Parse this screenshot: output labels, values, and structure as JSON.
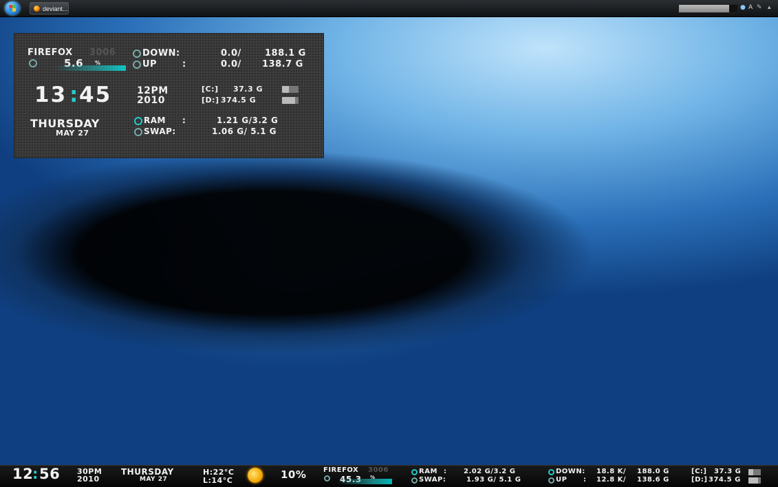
{
  "taskbar": {
    "task_label": "deviant...",
    "tray_icons": [
      "A"
    ]
  },
  "widget": {
    "process_name": "FIREFOX",
    "process_pid": "3006",
    "cpu_percent": "5.6",
    "cpu_unit": "%",
    "net_down_label": "DOWN:",
    "net_down_value": "0.0/",
    "net_down_total": "188.1 G",
    "net_up_label": "UP",
    "net_up_colon": ":",
    "net_up_value": "0.0/",
    "net_up_total": "138.7 G",
    "time": "13:45",
    "time_hh": "13",
    "time_mm": "45",
    "ampm": "12PM",
    "year": "2010",
    "drive_c_label": "[C:]",
    "drive_c_value": "37.3 G",
    "drive_d_label": "[D:]",
    "drive_d_value": "374.5 G",
    "day": "THURSDAY",
    "date": "MAY 27",
    "ram_label": "RAM",
    "ram_colon": ":",
    "ram_value": "1.21 G/3.2 G",
    "swap_label": "SWAP:",
    "swap_value": "1.06 G/ 5.1 G"
  },
  "bottom": {
    "time_hh": "12",
    "time_mm": "56",
    "ampm": "30PM",
    "year": "2010",
    "day": "THURSDAY",
    "date": "MAY 27",
    "temp_high": "H:22°C",
    "temp_low": "L:14°C",
    "humidity": "10%",
    "process_name": "FIREFOX",
    "process_pid": "3006",
    "cpu_percent": "45.3",
    "cpu_unit": "%",
    "ram_label": "RAM",
    "ram_colon": ":",
    "ram_value": "2.02 G/3.2 G",
    "swap_label": "SWAP:",
    "swap_value": "1.93 G/ 5.1 G",
    "down_label": "DOWN:",
    "down_value": "18.8 K/",
    "down_total": "188.0 G",
    "up_label": "UP",
    "up_colon": ":",
    "up_value": "12.8 K/",
    "up_total": "138.6 G",
    "drive_c_label": "[C:]",
    "drive_c_value": "37.3 G",
    "drive_d_label": "[D:]",
    "drive_d_value": "374.5 G"
  },
  "colors": {
    "accent": "#22cccc",
    "panel_bg": "#3d3d3d",
    "bar_bg": "#0a0a0a"
  }
}
